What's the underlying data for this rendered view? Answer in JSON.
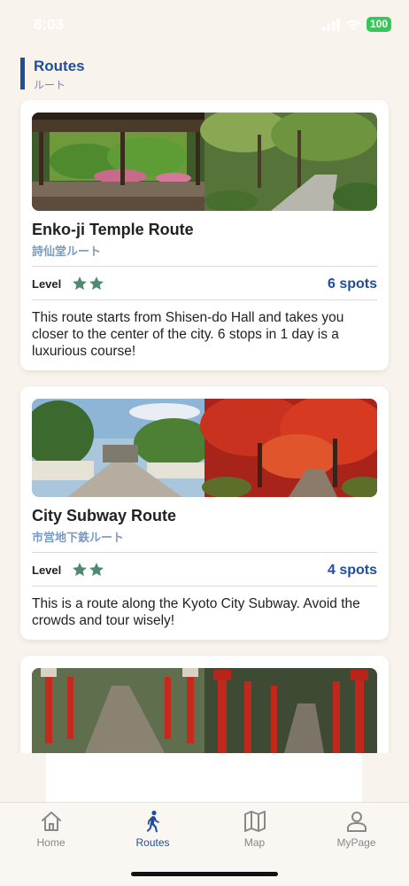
{
  "status": {
    "time": "8:03",
    "battery": "100"
  },
  "section": {
    "title": "Routes",
    "subtitle": "ルート"
  },
  "routes": [
    {
      "title": "Enko-ji Temple Route",
      "subtitle": "詩仙堂ルート",
      "level_label": "Level",
      "stars": 2,
      "spots": "6 spots",
      "description": "This route starts from Shisen-do Hall and takes you closer to the center of the city. 6 stops in 1 day is a luxurious course!"
    },
    {
      "title": "City Subway Route",
      "subtitle": "市営地下鉄ルート",
      "level_label": "Level",
      "stars": 2,
      "spots": "4 spots",
      "description": "This is a route along the Kyoto City Subway. Avoid the crowds and tour wisely!"
    }
  ],
  "tabbar": {
    "items": [
      {
        "label": "Home",
        "icon": "house-icon",
        "active": false
      },
      {
        "label": "Routes",
        "icon": "walking-person-icon",
        "active": true
      },
      {
        "label": "Map",
        "icon": "map-icon",
        "active": false
      },
      {
        "label": "MyPage",
        "icon": "person-icon",
        "active": false
      }
    ]
  },
  "colors": {
    "accent": "#1f4f9c",
    "star": "#4e8a6e",
    "background": "#f8f3ec"
  }
}
